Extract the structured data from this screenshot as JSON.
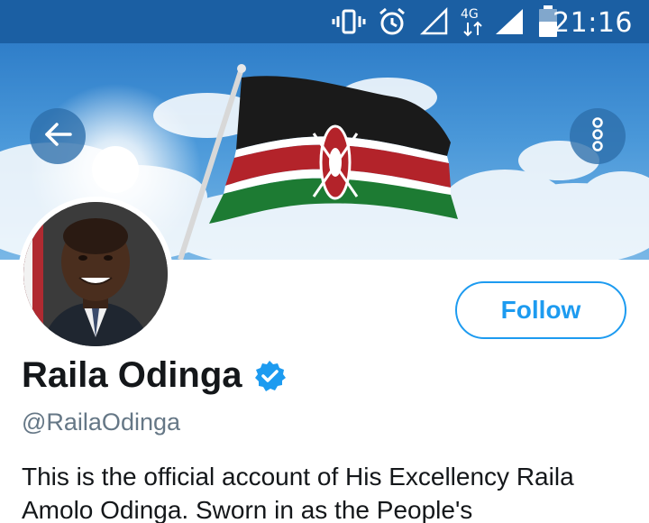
{
  "status_bar": {
    "time": "21:16",
    "network_label": "4G",
    "icons": [
      "vibrate-icon",
      "alarm-icon",
      "signal-outline-icon",
      "data-arrows-icon",
      "signal-full-icon",
      "battery-icon"
    ]
  },
  "header": {
    "back_icon": "arrow-left-icon",
    "more_icon": "more-vertical-icon",
    "banner_image": "kenya-flag-sky"
  },
  "profile": {
    "display_name": "Raila Odinga",
    "verified": true,
    "handle": "@RailaOdinga",
    "follow_label": "Follow",
    "bio": "This is the official account of His Excellency Raila Amolo Odinga. Sworn in as the People's"
  },
  "colors": {
    "status_bar": "#1b5fa3",
    "accent": "#1d9bf0",
    "text_primary": "#14171a",
    "text_secondary": "#657786"
  }
}
